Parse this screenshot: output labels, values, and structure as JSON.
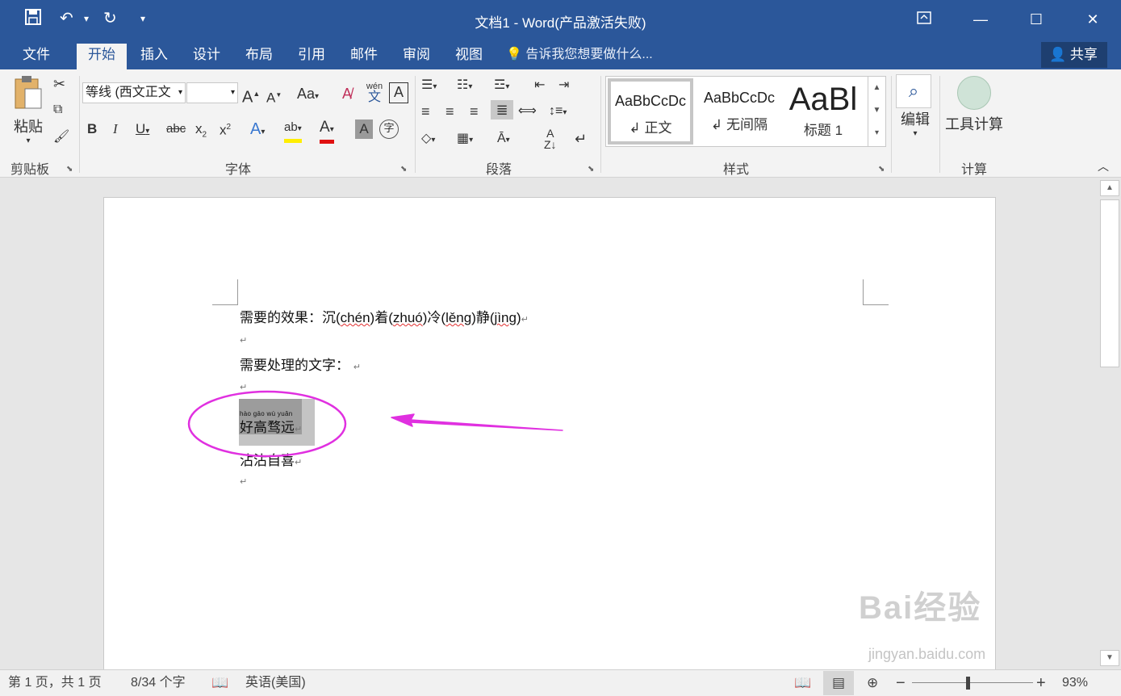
{
  "title": "文档1 - Word(产品激活失败)",
  "tabs": [
    "文件",
    "开始",
    "插入",
    "设计",
    "布局",
    "引用",
    "邮件",
    "审阅",
    "视图"
  ],
  "tell_me": "告诉我您想要做什么...",
  "share": "共享",
  "ribbon": {
    "clipboard": {
      "paste": "粘贴",
      "label": "剪贴板"
    },
    "font": {
      "family": "等线 (西文正文",
      "size": "",
      "change_case": "Aa",
      "phonetic_top": "wén",
      "phonetic_bottom": "文",
      "label": "字体"
    },
    "paragraph": {
      "label": "段落"
    },
    "styles": {
      "label": "样式",
      "items": [
        {
          "sample": "AaBbCcDc",
          "name": "↲ 正文"
        },
        {
          "sample": "AaBbCcDc",
          "name": "↲ 无间隔"
        },
        {
          "sample": "AaBl",
          "name": "标题 1"
        }
      ]
    },
    "editing": {
      "label": "编辑"
    },
    "calc": {
      "tool": "工具计算",
      "label": "计算"
    }
  },
  "document": {
    "line1": {
      "prefix": "需要的效果：沉(",
      "py1": "chén",
      "mid1": ")着(",
      "py2": "zhuó",
      "mid2": ")冷(",
      "py3": "lěng",
      "mid3": ")静(",
      "py4": "jìng",
      "suffix": ")"
    },
    "line2": "需要处理的文字：",
    "ruby": "hào gāo wù yuǎn",
    "line3": "好高骛远",
    "line4": "沾沾自喜"
  },
  "status": {
    "page": "第 1 页，共 1 页",
    "words": "8/34 个字",
    "language": "英语(美国)",
    "zoom": "93%"
  },
  "watermark": {
    "main": "Bai经验",
    "sub": "jingyan.baidu.com"
  }
}
